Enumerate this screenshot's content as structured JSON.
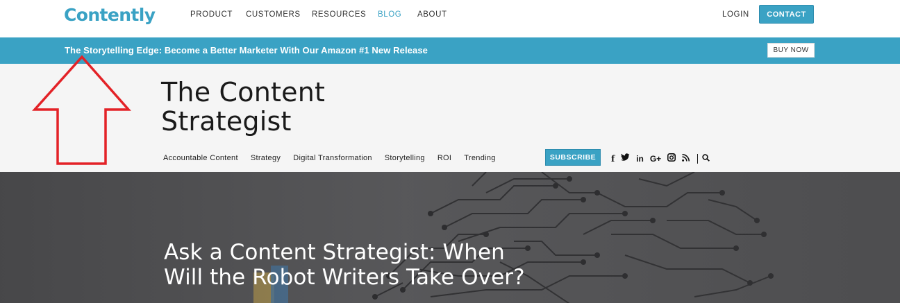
{
  "brand": {
    "logo_text": "Contently"
  },
  "nav": {
    "items": [
      {
        "label": "PRODUCT",
        "active": false
      },
      {
        "label": "CUSTOMERS",
        "active": false
      },
      {
        "label": "RESOURCES",
        "active": false
      },
      {
        "label": "BLOG",
        "active": true
      },
      {
        "label": "ABOUT",
        "active": false
      }
    ],
    "login_label": "LOGIN",
    "contact_label": "CONTACT"
  },
  "banner": {
    "text": "The Storytelling Edge: Become a Better Marketer With Our Amazon #1 New Release",
    "buy_label": "BUY NOW"
  },
  "blog": {
    "title_line1": "The Content",
    "title_line2": "Strategist",
    "categories": [
      "Accountable Content",
      "Strategy",
      "Digital Transformation",
      "Storytelling",
      "ROI",
      "Trending"
    ],
    "subscribe_label": "SUBSCRIBE",
    "social_icons": [
      "facebook-icon",
      "twitter-icon",
      "linkedin-icon",
      "google-plus-icon",
      "instagram-icon",
      "rss-icon",
      "search-icon"
    ]
  },
  "hero": {
    "title_line1": "Ask a Content Strategist: When",
    "title_line2": "Will the Robot Writers Take Over?"
  },
  "colors": {
    "accent": "#3aa2c4",
    "annotation": "#e32227",
    "header_bg": "#f5f5f5",
    "hero_bg": "#555557"
  }
}
